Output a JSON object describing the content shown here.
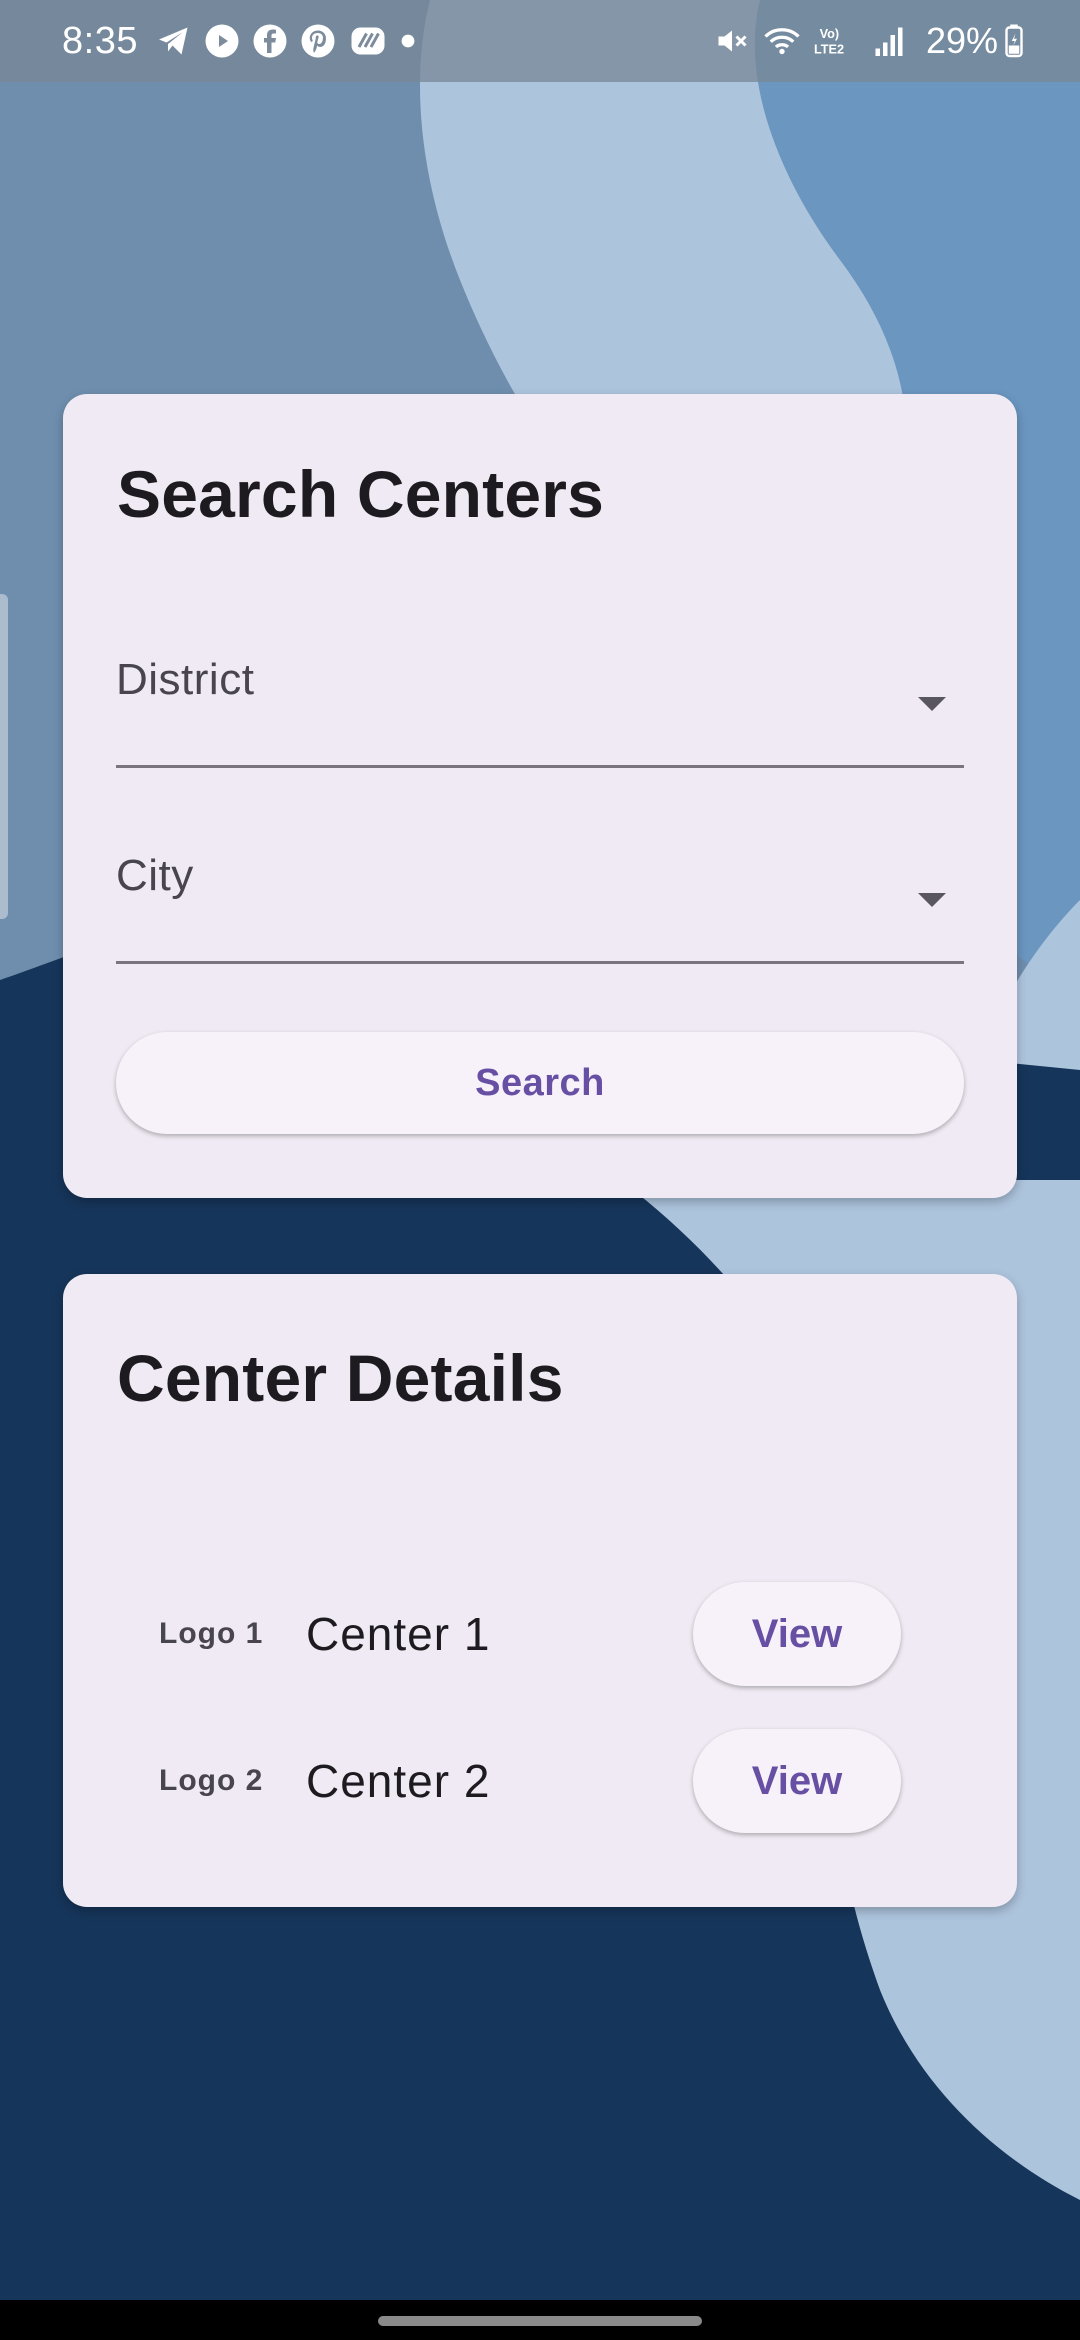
{
  "status_bar": {
    "time": "8:35",
    "battery": "29%",
    "network": "Vo) LTE2",
    "icons": [
      "telegram-icon",
      "youtube-icon",
      "facebook-icon",
      "pinterest-icon",
      "app-icon",
      "notification-dot-icon",
      "mute-icon",
      "wifi-icon",
      "volte-icon",
      "signal-icon",
      "battery-icon"
    ]
  },
  "search_card": {
    "title": "Search Centers",
    "district_label": "District",
    "city_label": "City",
    "search_button": "Search"
  },
  "details_card": {
    "title": "Center Details",
    "centers": [
      {
        "logo": "Logo 1",
        "name": "Center 1",
        "action": "View"
      },
      {
        "logo": "Logo 2",
        "name": "Center 2",
        "action": "View"
      }
    ]
  },
  "colors": {
    "card_bg": "#efeaf3",
    "accent": "#6750a4",
    "background_dark": "#16355a",
    "background_light": "#adc4dd",
    "background_mid": "#6b96c0"
  }
}
